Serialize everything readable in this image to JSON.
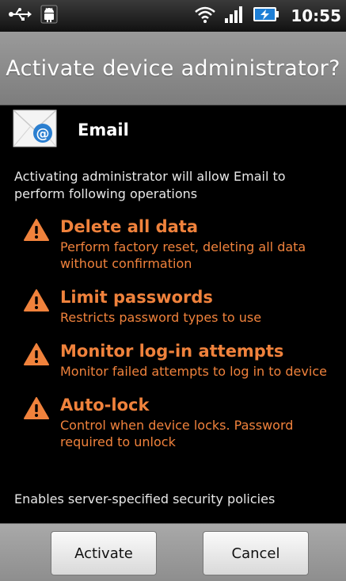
{
  "status_bar": {
    "icons": [
      "usb-icon",
      "android-debug-icon",
      "wifi-icon",
      "signal-icon",
      "battery-charging-icon"
    ],
    "time": "10:55"
  },
  "dialog": {
    "title": "Activate device administrator?",
    "app_name": "Email",
    "app_icon": "email-icon",
    "intro": "Activating administrator will allow Email to perform following operations",
    "permissions": [
      {
        "title": "Delete all data",
        "description": "Perform factory reset, deleting all data without confirmation",
        "icon": "warning-icon"
      },
      {
        "title": "Limit passwords",
        "description": "Restricts password types to use",
        "icon": "warning-icon"
      },
      {
        "title": "Monitor log-in attempts",
        "description": "Monitor failed attempts to log in to device",
        "icon": "warning-icon"
      },
      {
        "title": "Auto-lock",
        "description": "Control when device locks. Password required to unlock",
        "icon": "warning-icon"
      }
    ],
    "footer": "Enables server-specified security policies"
  },
  "buttons": {
    "activate": "Activate",
    "cancel": "Cancel"
  },
  "colors": {
    "accent": "#f0823c",
    "title_bar": "#8c8c8c",
    "background": "#000000"
  }
}
